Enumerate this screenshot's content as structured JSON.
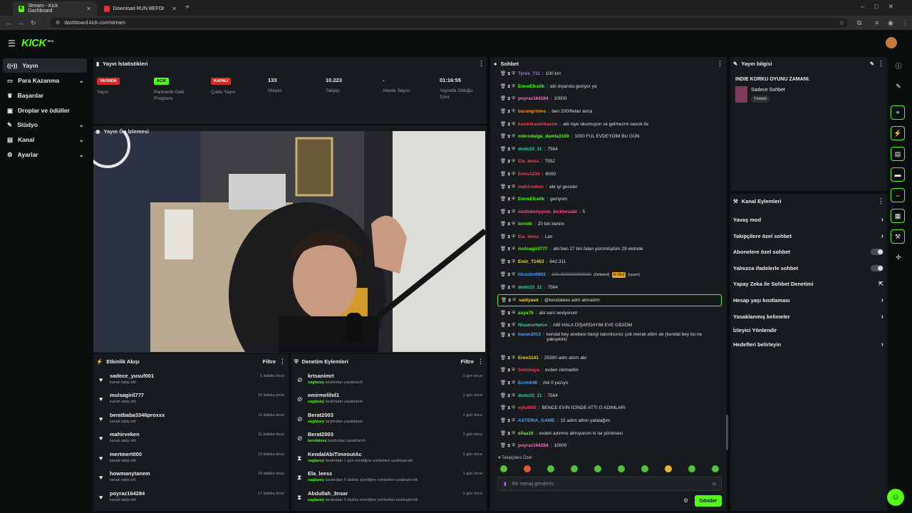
{
  "browser": {
    "tabs": [
      {
        "label": "Stream - Kick Dashboard"
      },
      {
        "label": "Download RUN BEFORE HE KN..."
      }
    ],
    "url": "dashboard.kick.com/stream"
  },
  "brand": {
    "logo": "KICK",
    "beta": "BETA"
  },
  "colors": {
    "accent": "#53fc18",
    "live": "#d62a2a",
    "bg": "#0b0e0f",
    "panel": "#181b1d"
  },
  "sidebar": {
    "items": [
      {
        "label": "Yayın",
        "icon": "broadcast-icon",
        "chevron": false
      },
      {
        "label": "Para Kazanma",
        "icon": "money-icon",
        "chevron": true
      },
      {
        "label": "Başarılar",
        "icon": "trophy-icon",
        "chevron": false
      },
      {
        "label": "Droplar ve ödüller",
        "icon": "gift-icon",
        "chevron": false
      },
      {
        "label": "Stüdyo",
        "icon": "studio-icon",
        "chevron": true
      },
      {
        "label": "Kanal",
        "icon": "channel-icon",
        "chevron": true
      },
      {
        "label": "Ayarlar",
        "icon": "gear-icon",
        "chevron": true
      }
    ]
  },
  "stats": {
    "title": "Yayın İstatistikleri",
    "items": [
      {
        "value": "YAYINDA",
        "label": "Yayın",
        "badge": "red"
      },
      {
        "value": "AÇIK",
        "label": "Partnerlik Gelir Programı",
        "badge": "green"
      },
      {
        "value": "KAPALI",
        "label": "Çoklu Yayın",
        "badge": "red"
      },
      {
        "value": "133",
        "label": "İzleyici"
      },
      {
        "value": "10.223",
        "label": "Takipçi"
      },
      {
        "value": "-",
        "label": "Abone Sayısı"
      },
      {
        "value": "01:16:55",
        "label": "Yayında Olduğu Süre"
      }
    ]
  },
  "preview": {
    "title": "Yayın Ön İzlemesi"
  },
  "activity": {
    "title": "Etkinlik Akışı",
    "filter": "Filtre",
    "items": [
      {
        "name": "sadece_yusuf001",
        "sub": "kanalı takip etti",
        "time": "1 dakika önce"
      },
      {
        "name": "mulsagiril777",
        "sub": "kanalı takip etti",
        "time": "10 dakika önce"
      },
      {
        "name": "beratbaba3346proxxx",
        "sub": "kanalı takip etti",
        "time": "11 dakika önce"
      },
      {
        "name": "mahirveken",
        "sub": "kanalı takip etti",
        "time": "11 dakika önce"
      },
      {
        "name": "mertmert000",
        "sub": "kanalı takip etti",
        "time": "13 dakika önce"
      },
      {
        "name": "howmanytanem",
        "sub": "kanalı takip etti",
        "time": "16 dakika önce"
      },
      {
        "name": "poyraz164284",
        "sub": "kanalı takip etti",
        "time": "17 dakika önce"
      }
    ]
  },
  "moderation": {
    "title": "Denetim Eylemleri",
    "filter": "Filtre",
    "items": [
      {
        "name": "krtsanimrt",
        "by": "caglazey",
        "sub": "tarafından yasaklandı",
        "time": "1 gün önce",
        "icon": "ban-icon"
      },
      {
        "name": "emirmelihd1",
        "by": "caglazey",
        "sub": "tarafından yasaklandı",
        "time": "1 gün önce",
        "icon": "ban-icon"
      },
      {
        "name": "Berat2003",
        "by": "caglazey",
        "sub": "tarafından yasaklandı",
        "time": "1 gün önce",
        "icon": "ban-icon"
      },
      {
        "name": "Berat2003",
        "by": "kendalees",
        "sub": "tarafından yasaklandı",
        "time": "1 gün önce",
        "icon": "ban-icon"
      },
      {
        "name": "KendalAbiTimeoutAc",
        "by": "caglazey",
        "sub": "tarafından 1 gün süreliğine sohbetten uzaklaştırıldı",
        "time": "1 gün önce",
        "icon": "hourglass-icon"
      },
      {
        "name": "Ela_leess",
        "by": "caglazey",
        "sub": "tarafından 5 dakika süreliğine sohbetten uzaklaştırıldı",
        "time": "1 gün önce",
        "icon": "hourglass-icon"
      },
      {
        "name": "Abdullah_3nsar",
        "by": "caglazey",
        "sub": "tarafından 5 dakika süreliğine sohbetten uzaklaştırıldı",
        "time": "1 gün önce",
        "icon": "hourglass-icon"
      }
    ]
  },
  "chat": {
    "title": "Sohbet",
    "followers_only": "Takipçilere Özel",
    "placeholder": "Bir mesaj gönderin",
    "send": "Gönder",
    "messages": [
      {
        "user": "Tyrex_711",
        "color": "#a970ff",
        "text": "100 km"
      },
      {
        "user": "EmreEfcelik",
        "color": "#53fc18",
        "text": "abi dışarıda geziyor ya"
      },
      {
        "user": "poyraz164284",
        "color": "#ff6ec7",
        "text": "10000"
      },
      {
        "user": "borangrimes",
        "color": "#ff8c1a",
        "text": "ben 2000felan anca"
      },
      {
        "user": "kasimkasimkasim",
        "color": "#ff3a55",
        "text": "abi niye okumuyon ve gelmezmi seeok ile"
      },
      {
        "user": "mikrodalga_damla3169",
        "color": "#53fc18",
        "text": "1000 FUL EVDEYDİM BU GÜN"
      },
      {
        "user": "dodo33_11",
        "color": "#3ad29f",
        "text": "7564"
      },
      {
        "user": "Ela_leess",
        "color": "#ff3a55",
        "text": "7552"
      },
      {
        "user": "Emre1234",
        "color": "#ff3a55",
        "text": "8000"
      },
      {
        "user": "mahirveken",
        "color": "#ff3a55",
        "text": "abi iyi geceler"
      },
      {
        "user": "EmreEfcelik",
        "color": "#53fc18",
        "text": "geziyom"
      },
      {
        "user": "mutlukedyynin_kickhesabi",
        "color": "#ff4f8a",
        "text": "5"
      },
      {
        "user": "lorintk",
        "color": "#53fc18",
        "text": "20 bin benim"
      },
      {
        "user": "Ela_leess",
        "color": "#ff3a55",
        "text": "Lan"
      },
      {
        "user": "mulsagiril777",
        "color": "#53fc18",
        "text": "abi ben 27 bin falan yürümüştüm 29 ekimde"
      },
      {
        "user": "Emir_T1453",
        "color": "#f5d342",
        "text": "642.311"
      },
      {
        "user": "htcozkn0602",
        "color": "#4aa3ff",
        "text": "100.000000000000",
        "deleted": true,
        "deleted_label": "(Deleted)",
        "ai": "AI Mod",
        "spam": "[spam]"
      },
      {
        "user": "dodo33_11",
        "color": "#3ad29f",
        "text": "7564"
      },
      {
        "user": "saidyasir",
        "color": "#f5d342",
        "text": "@kendalees adm atmadım",
        "highlight": true
      },
      {
        "user": "asya76",
        "color": "#53fc18",
        "text": "abi seni seviyorum"
      },
      {
        "user": "Nisanurhelco",
        "color": "#3ad29f",
        "text": "ABİ HALA DİŞARDAYIM EVE GİDİOM"
      },
      {
        "user": "baran2013",
        "color": "#4aa3ff",
        "text": "kendal bey acebesi hangi takımlısınız çok merak ettim de (kendal bey bu ne yakışıklık)"
      },
      {
        "user": "Eren3141",
        "color": "#f5d342",
        "text": "25390 adm attım abi"
      },
      {
        "user": "Selinkaya",
        "color": "#ff3a55",
        "text": "evden cikmadim"
      },
      {
        "user": "Ecrin648",
        "color": "#4aa3ff",
        "text": "Abi 0 yazıyo"
      },
      {
        "user": "dodo33_11",
        "color": "#3ad29f",
        "text": "7564"
      },
      {
        "user": "eylul005",
        "color": "#ff3a55",
        "text": "BENCE EVİN İCİNDE ATTI O ADIMLARI"
      },
      {
        "user": "ASTERIA_GAME",
        "color": "#4aa3ff",
        "text": "15 adım attım yatalağım"
      },
      {
        "user": "ellaa16",
        "color": "#53fc18",
        "text": "evden adımmı atmıyorum ki ne yürümesi"
      },
      {
        "user": "poyraz164284",
        "color": "#ff6ec7",
        "text": "10000"
      }
    ]
  },
  "info": {
    "title": "Yayın bilgisi",
    "stream_title": "INDIE KORKU OYUNU ZAMANI.",
    "category": "Sadece Sohbet",
    "tag": "Türkish"
  },
  "channel_actions": {
    "title": "Kanal Eylemleri",
    "items": [
      {
        "label": "Yavaş mod",
        "control": "arrow"
      },
      {
        "label": "Takipçilere özel sohbet",
        "control": "arrow"
      },
      {
        "label": "Abonelere özel sohbet",
        "control": "toggle"
      },
      {
        "label": "Yalnızca ifadelerle sohbet",
        "control": "toggle"
      },
      {
        "label": "Yapay Zeka ile Sohbet Denetimi",
        "control": "external"
      },
      {
        "label": "Hesap yaşı kısıtlaması",
        "control": "arrow"
      },
      {
        "label": "Yasaklanmış kelimeler",
        "control": "arrow"
      },
      {
        "label": "İzleyici Yönlendir",
        "control": "none"
      },
      {
        "label": "Hedefleri belirleyin",
        "control": "arrow"
      }
    ]
  }
}
